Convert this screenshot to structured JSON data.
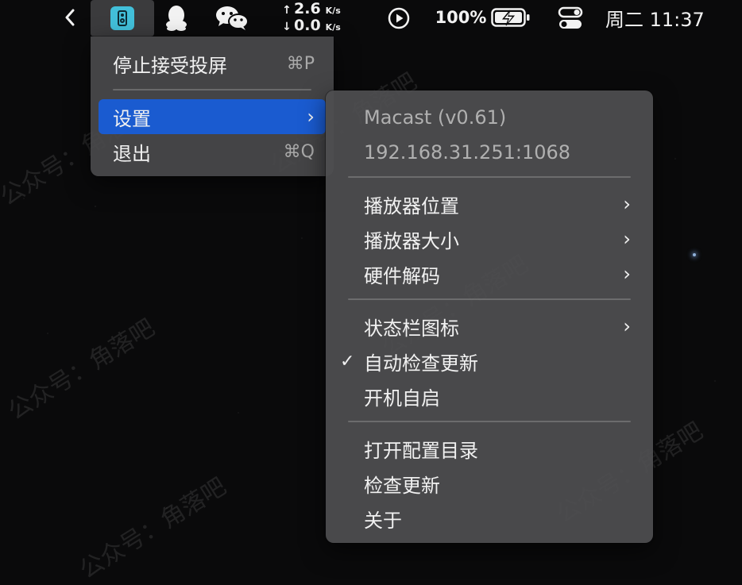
{
  "statusbar": {
    "net_up_value": "2.6",
    "net_up_unit": "K/s",
    "net_down_value": "0.0",
    "net_down_unit": "K/s",
    "battery_percent": "100%",
    "clock": "周二 11:37",
    "icons": [
      "chevron-left-icon",
      "macast-app-icon",
      "qq-icon",
      "wechat-icon",
      "play-circle-icon",
      "battery-charging-icon",
      "control-center-icon"
    ]
  },
  "main_menu": {
    "items": [
      {
        "label": "停止接受投屏",
        "shortcut": "⌘P"
      },
      {
        "label": "设置",
        "arrow": "›"
      },
      {
        "label": "退出",
        "shortcut": "⌘Q"
      }
    ]
  },
  "settings_menu": {
    "app_version": "Macast (v0.61)",
    "address": "192.168.31.251:1068",
    "items": [
      {
        "label": "播放器位置"
      },
      {
        "label": "播放器大小"
      },
      {
        "label": "硬件解码"
      },
      {
        "label": "状态栏图标"
      },
      {
        "label": "自动检查更新",
        "checked": true
      },
      {
        "label": "开机自启"
      },
      {
        "label": "打开配置目录"
      },
      {
        "label": "检查更新"
      },
      {
        "label": "关于"
      }
    ],
    "check_mark": "✓",
    "arrow": "›"
  },
  "watermark": {
    "text": "公众号：角落吧"
  },
  "colors": {
    "highlight": "#1a5bd0",
    "app_icon": "#42bfd9",
    "menu_bg": "#4a4a4c"
  }
}
